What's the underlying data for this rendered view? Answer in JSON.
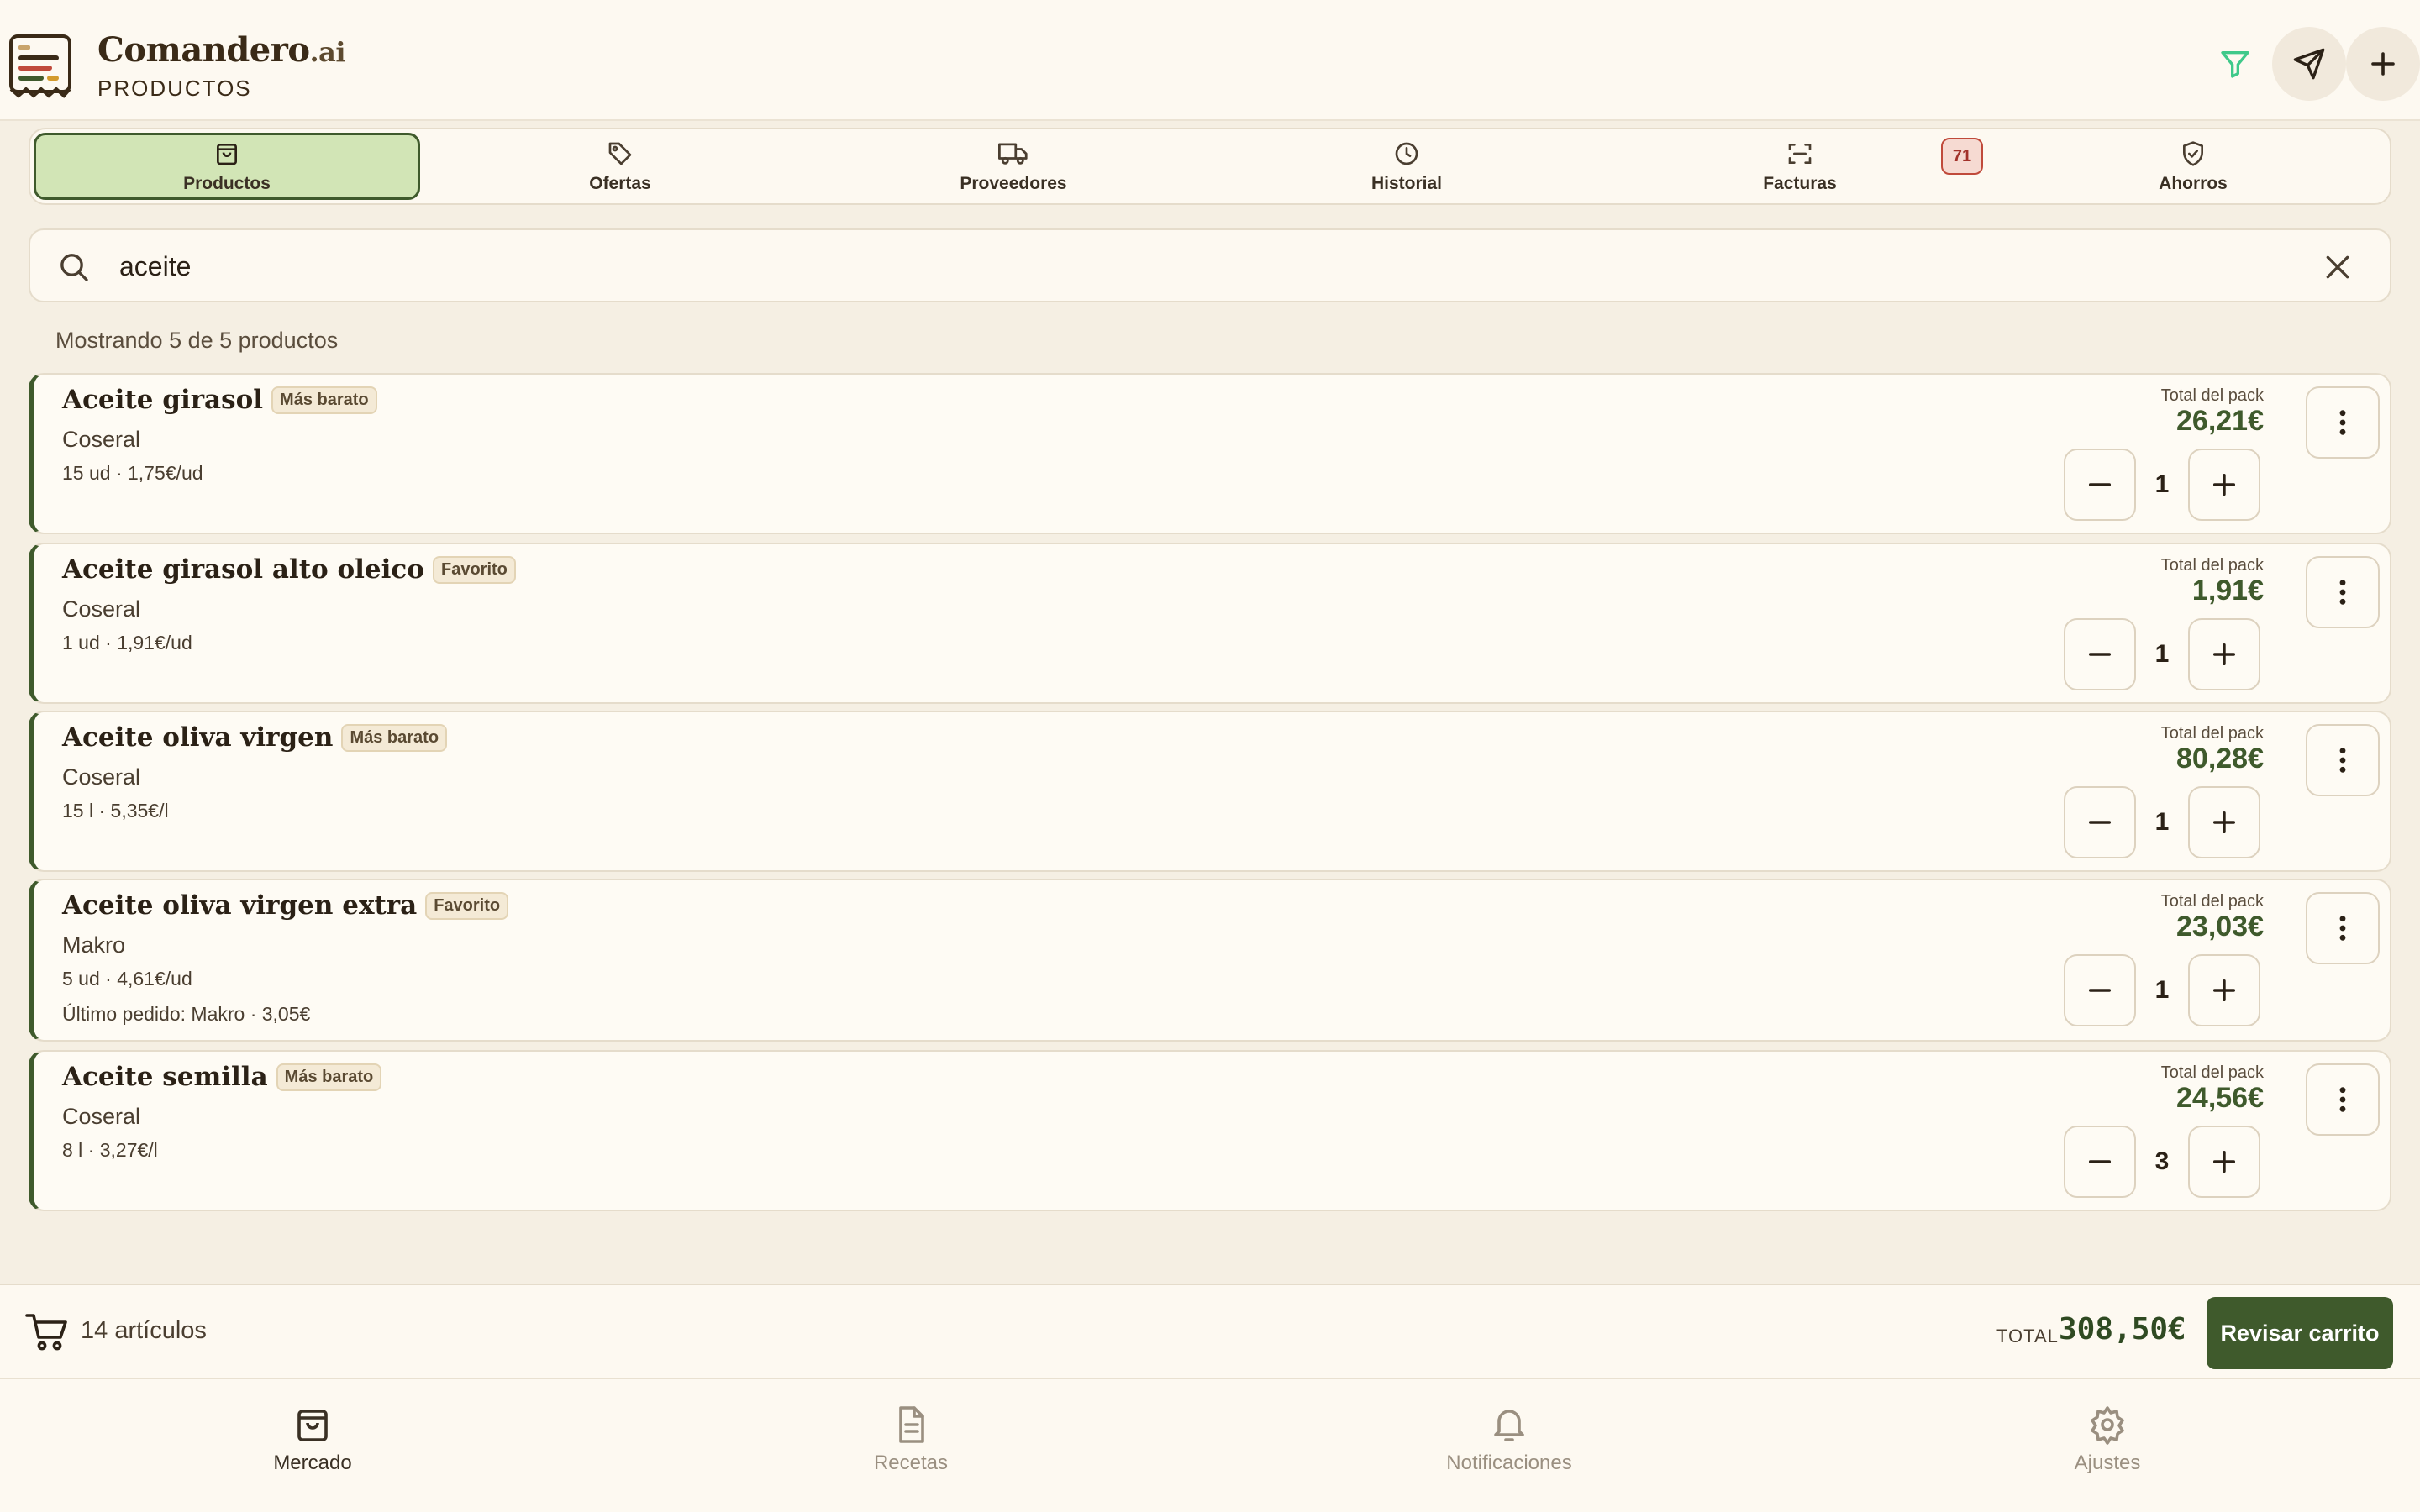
{
  "header": {
    "brand_main": "Comandero",
    "brand_suffix": ".ai",
    "subtitle": "PRODUCTOS"
  },
  "tabs": [
    {
      "label": "Productos",
      "icon": "shopping-bag-icon",
      "active": true
    },
    {
      "label": "Ofertas",
      "icon": "tag-icon"
    },
    {
      "label": "Proveedores",
      "icon": "truck-icon"
    },
    {
      "label": "Historial",
      "icon": "clock-icon"
    },
    {
      "label": "Facturas",
      "icon": "scan-icon",
      "badge": "71"
    },
    {
      "label": "Ahorros",
      "icon": "shield-check-icon"
    }
  ],
  "search": {
    "value": "aceite"
  },
  "results_count": "Mostrando 5 de 5 productos",
  "products": [
    {
      "name": "Aceite girasol",
      "tag": "Más barato",
      "supplier": "Coseral",
      "unit": "15 ud · 1,75€/ud",
      "last_order": "",
      "total_label": "Total del pack",
      "total": "26,21€",
      "qty": "1"
    },
    {
      "name": "Aceite girasol alto oleico",
      "tag": "Favorito",
      "supplier": "Coseral",
      "unit": "1 ud · 1,91€/ud",
      "last_order": "",
      "total_label": "Total del pack",
      "total": "1,91€",
      "qty": "1"
    },
    {
      "name": "Aceite oliva virgen",
      "tag": "Más barato",
      "supplier": "Coseral",
      "unit": "15 l · 5,35€/l",
      "last_order": "",
      "total_label": "Total del pack",
      "total": "80,28€",
      "qty": "1"
    },
    {
      "name": "Aceite oliva virgen extra",
      "tag": "Favorito",
      "supplier": "Makro",
      "unit": "5 ud · 4,61€/ud",
      "last_order": "Último pedido: Makro · 3,05€",
      "total_label": "Total del pack",
      "total": "23,03€",
      "qty": "1"
    },
    {
      "name": "Aceite semilla",
      "tag": "Más barato",
      "supplier": "Coseral",
      "unit": "8 l · 3,27€/l",
      "last_order": "",
      "total_label": "Total del pack",
      "total": "24,56€",
      "qty": "3"
    }
  ],
  "cart": {
    "items_label": "14 artículos",
    "total_word": "TOTAL",
    "total_value": "308,50€",
    "review_label": "Revisar carrito"
  },
  "bottom_nav": [
    {
      "label": "Mercado",
      "icon": "shopping-bag-icon",
      "active": true
    },
    {
      "label": "Recetas",
      "icon": "document-icon"
    },
    {
      "label": "Notificaciones",
      "icon": "bell-icon"
    },
    {
      "label": "Ajustes",
      "icon": "gear-icon"
    }
  ],
  "colors": {
    "background": "#f5efe3",
    "surface": "#fdf9f1",
    "accent_green": "#3f5a2c",
    "active_tab": "#d2e5b6",
    "badge_red": "#c04a3b",
    "filter_icon": "#3fc98a"
  }
}
